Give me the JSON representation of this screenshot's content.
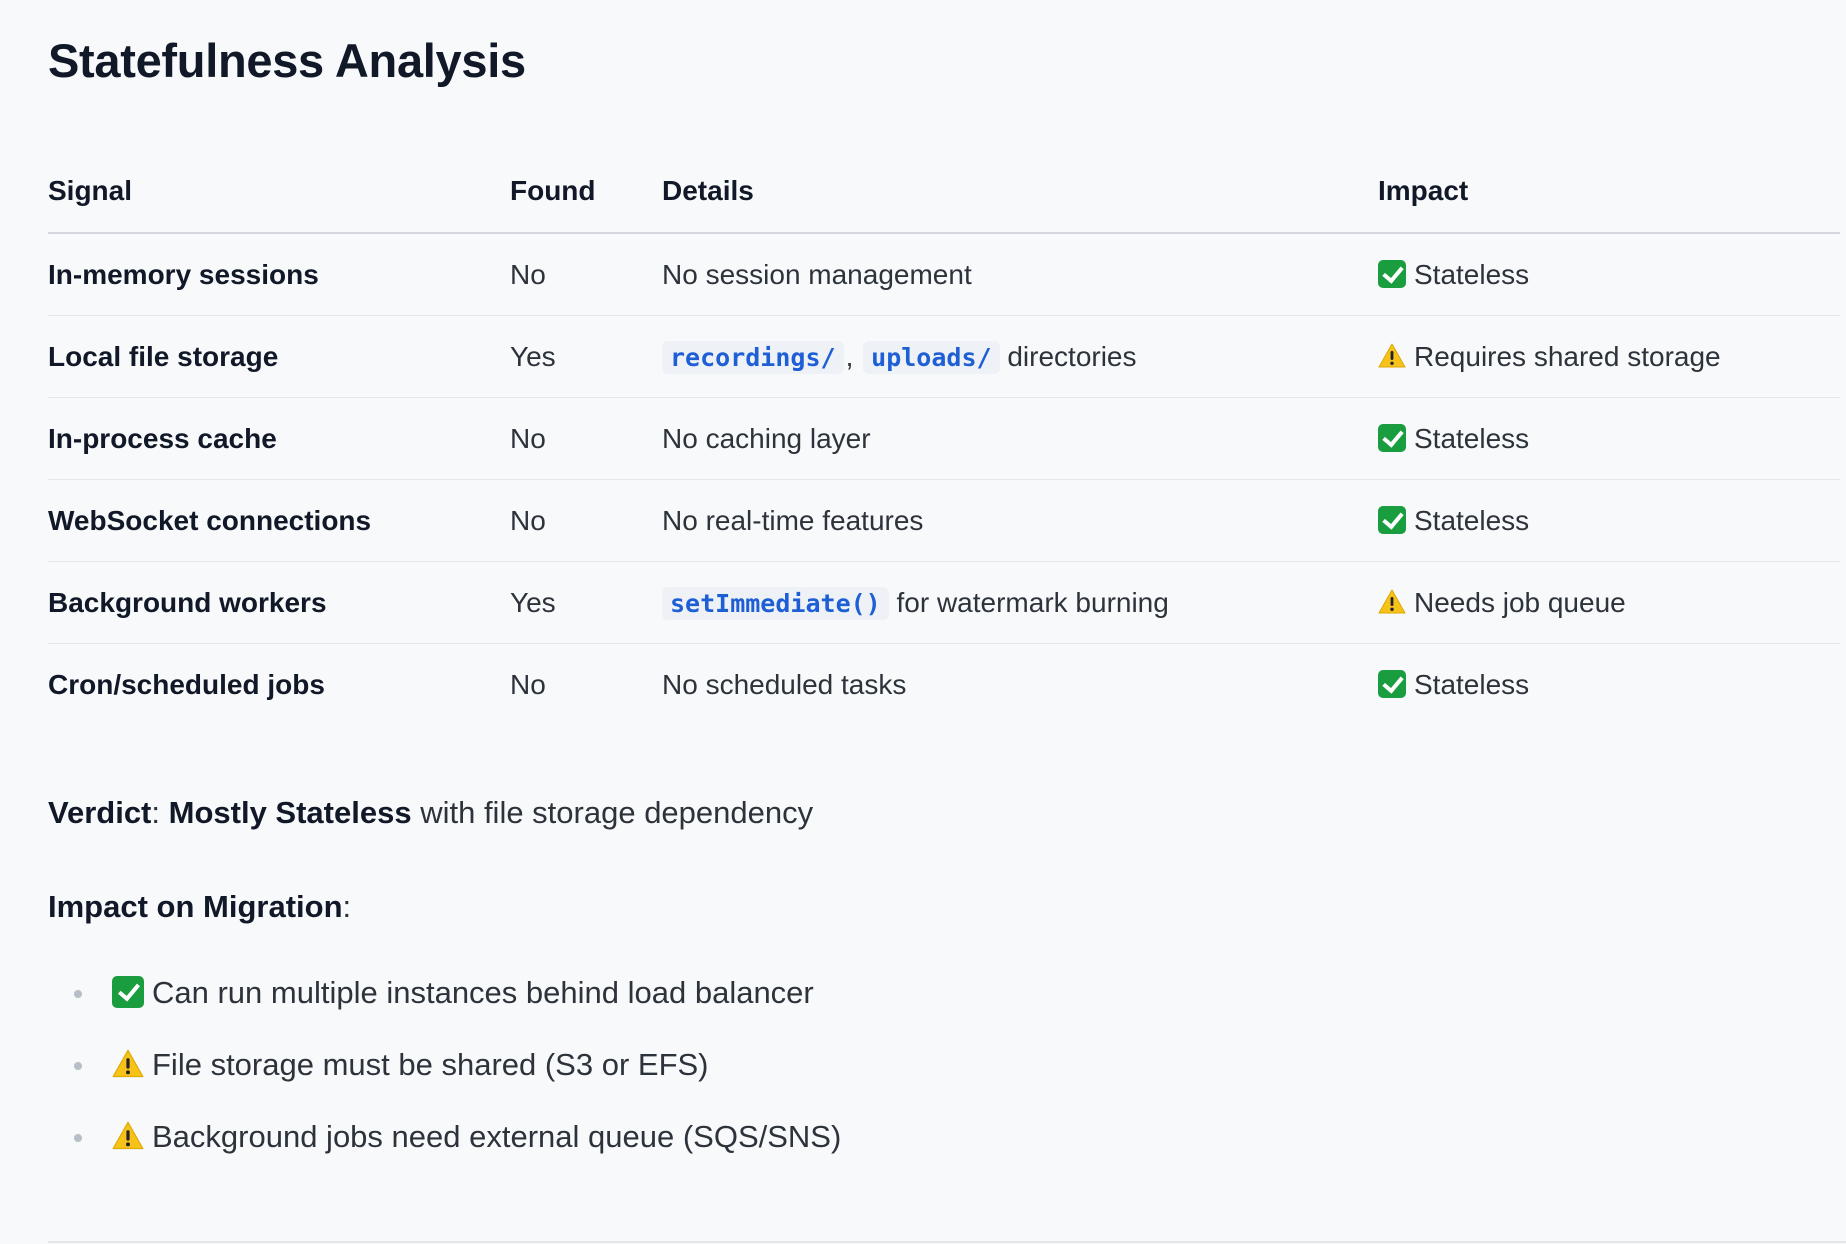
{
  "title": "Statefulness Analysis",
  "table": {
    "headers": [
      "Signal",
      "Found",
      "Details",
      "Impact"
    ],
    "rows": [
      {
        "signal": "In-memory sessions",
        "found": "No",
        "details": "No session management",
        "impact_icon": "check-icon",
        "impact": "Stateless"
      },
      {
        "signal": "Local file storage",
        "found": "Yes",
        "details_code_1": "recordings/",
        "details_sep": ",",
        "details_code_2": "uploads/",
        "details_suffix": "directories",
        "impact_icon": "warning-icon",
        "impact": "Requires shared storage"
      },
      {
        "signal": "In-process cache",
        "found": "No",
        "details": "No caching layer",
        "impact_icon": "check-icon",
        "impact": "Stateless"
      },
      {
        "signal": "WebSocket connections",
        "found": "No",
        "details": "No real-time features",
        "impact_icon": "check-icon",
        "impact": "Stateless"
      },
      {
        "signal": "Background workers",
        "found": "Yes",
        "details_code_1": "setImmediate()",
        "details_suffix": "for watermark burning",
        "impact_icon": "warning-icon",
        "impact": "Needs job queue"
      },
      {
        "signal": "Cron/scheduled jobs",
        "found": "No",
        "details": "No scheduled tasks",
        "impact_icon": "check-icon",
        "impact": "Stateless"
      }
    ]
  },
  "verdict": {
    "label": "Verdict",
    "colon": ":",
    "value": "Mostly Stateless",
    "suffix": "with file storage dependency"
  },
  "impact_section": {
    "heading": "Impact on Migration",
    "colon": ":",
    "items": [
      {
        "icon": "check-icon",
        "text": "Can run multiple instances behind load balancer"
      },
      {
        "icon": "warning-icon",
        "text": "File storage must be shared (S3 or EFS)"
      },
      {
        "icon": "warning-icon",
        "text": "Background jobs need external queue (SQS/SNS)"
      }
    ]
  },
  "colors": {
    "check_green": "#1a9d3f",
    "warning_yellow": "#f7c21a",
    "code_blue": "#1f5fd6",
    "background": "#f8f9fb"
  }
}
